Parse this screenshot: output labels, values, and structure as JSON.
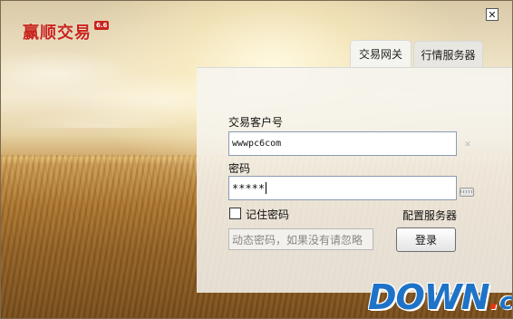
{
  "app": {
    "brand_name": "赢顺交易",
    "brand_version": "6.6"
  },
  "window": {
    "close_glyph": "✕"
  },
  "tabs": [
    {
      "label": "交易网关",
      "active": true
    },
    {
      "label": "行情服务器",
      "active": false
    }
  ],
  "login": {
    "account_label": "交易客户号",
    "account_value": "wwwpc6com",
    "password_label": "密码",
    "password_value": "*****",
    "remember_label": "记住密码",
    "remember_checked": false,
    "config_server_label": "配置服务器",
    "dynamic_password_placeholder": "动态密码，如果没有请忽略",
    "login_button_label": "登录"
  },
  "icons": {
    "clear_account": "clear-icon",
    "soft_keyboard": "keyboard-icon",
    "close": "close-icon"
  },
  "watermark": {
    "main": "DOWN",
    "dot": ".",
    "suffix": "cc"
  },
  "colors": {
    "brand_red": "#c8241b",
    "watermark_blue": "#1e73c8",
    "watermark_dot": "#e8340f"
  }
}
